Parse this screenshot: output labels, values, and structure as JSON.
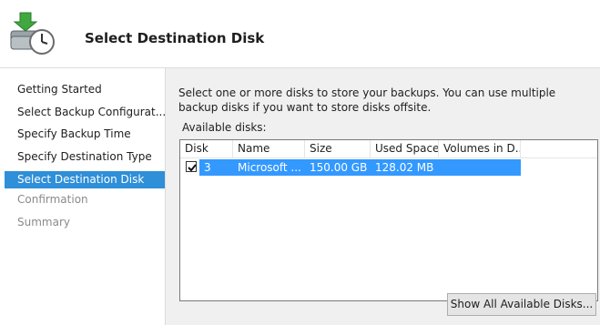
{
  "header": {
    "title": "Select Destination Disk",
    "logo_icon": "backup-clock-icon"
  },
  "sidebar": {
    "items": [
      {
        "label": "Getting Started",
        "state": "normal"
      },
      {
        "label": "Select Backup Configurat...",
        "state": "normal"
      },
      {
        "label": "Specify Backup Time",
        "state": "normal"
      },
      {
        "label": "Specify Destination Type",
        "state": "normal"
      },
      {
        "label": "Select Destination Disk",
        "state": "active"
      },
      {
        "label": "Confirmation",
        "state": "disabled"
      },
      {
        "label": "Summary",
        "state": "disabled"
      }
    ]
  },
  "main": {
    "description": "Select one or more disks to store your backups. You can use multiple backup disks if you want to store disks offsite.",
    "available_label": "Available disks:",
    "table": {
      "columns": [
        "Disk",
        "Name",
        "Size",
        "Used Space",
        "Volumes in D..."
      ],
      "rows": [
        {
          "checked": true,
          "disk": "3",
          "name": "Microsoft ...",
          "size": "150.00 GB",
          "used": "128.02 MB",
          "volumes": ""
        }
      ]
    },
    "show_all_button": "Show All Available Disks..."
  },
  "colors": {
    "accent": "#2f8fd8",
    "selection": "#3399ff",
    "panel": "#f0f0f0"
  }
}
